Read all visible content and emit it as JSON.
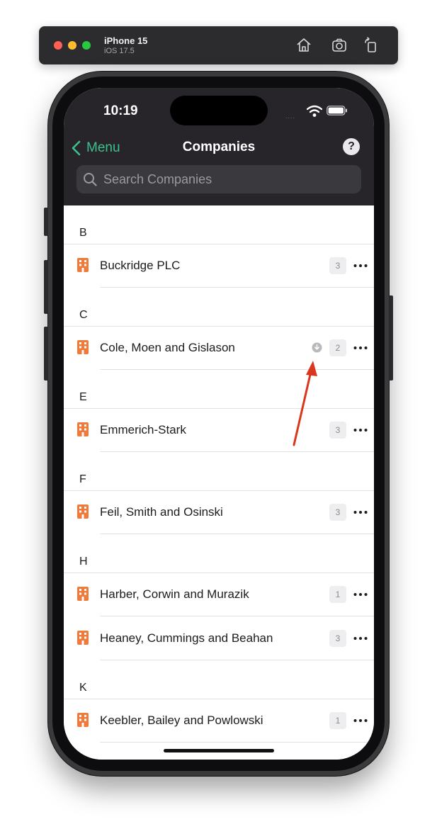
{
  "simulator": {
    "device_name": "iPhone 15",
    "os_version": "iOS 17.5",
    "tools": [
      "home-icon",
      "screenshot-icon",
      "rotate-icon"
    ]
  },
  "status_bar": {
    "time": "10:19",
    "signal": "....",
    "icons": [
      "wifi-icon",
      "battery-icon"
    ]
  },
  "nav": {
    "back_label": "Menu",
    "title": "Companies",
    "help_label": "?"
  },
  "search": {
    "placeholder": "Search Companies",
    "value": ""
  },
  "sections": [
    {
      "letter": "B",
      "items": [
        {
          "name": "Buckridge PLC",
          "count": "3"
        }
      ]
    },
    {
      "letter": "C",
      "items": [
        {
          "name": "Cole, Moen and Gislason",
          "count": "2",
          "status_icon": "download-icon"
        }
      ]
    },
    {
      "letter": "E",
      "items": [
        {
          "name": "Emmerich-Stark",
          "count": "3"
        }
      ]
    },
    {
      "letter": "F",
      "items": [
        {
          "name": "Feil, Smith and Osinski",
          "count": "3"
        }
      ]
    },
    {
      "letter": "H",
      "items": [
        {
          "name": "Harber, Corwin and Murazik",
          "count": "1"
        },
        {
          "name": "Heaney, Cummings and Beahan",
          "count": "3"
        }
      ]
    },
    {
      "letter": "K",
      "items": [
        {
          "name": "Keebler, Bailey and Powlowski",
          "count": "1"
        }
      ]
    }
  ],
  "colors": {
    "nav_background": "#27252a",
    "accent_green": "#3cc08e",
    "company_icon": "#f07a3a",
    "annotation_arrow": "#d9381e"
  }
}
